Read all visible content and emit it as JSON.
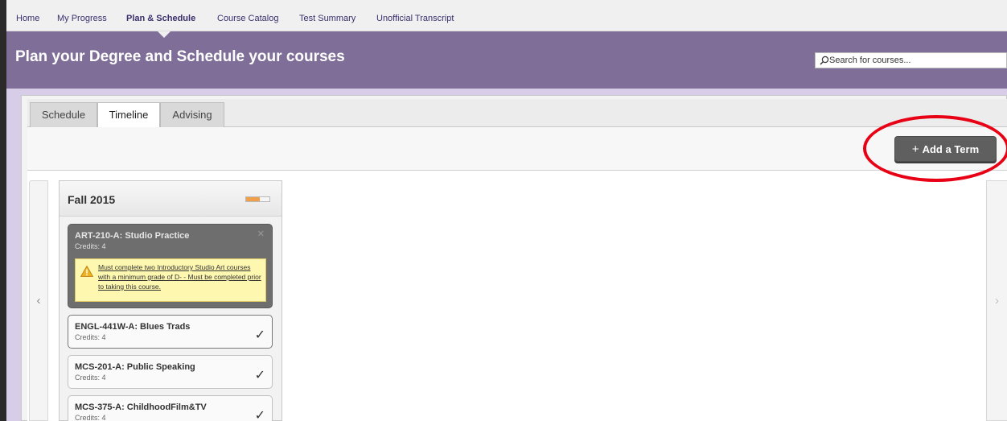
{
  "nav": {
    "items": [
      {
        "label": "Home"
      },
      {
        "label": "My Progress"
      },
      {
        "label": "Plan & Schedule",
        "active": true
      },
      {
        "label": "Course Catalog"
      },
      {
        "label": "Test Summary"
      },
      {
        "label": "Unofficial Transcript"
      }
    ]
  },
  "header": {
    "title": "Plan your Degree and Schedule your courses",
    "search_placeholder": "Search for courses..."
  },
  "tabs": [
    {
      "label": "Schedule"
    },
    {
      "label": "Timeline",
      "active": true
    },
    {
      "label": "Advising"
    }
  ],
  "toolbar": {
    "add_term_label": "Add a Term",
    "add_term_plus": "+"
  },
  "term": {
    "title": "Fall 2015",
    "progress_fraction": 0.6,
    "courses": [
      {
        "name": "ART-210-A: Studio Practice",
        "credits": "Credits: 4",
        "warning": "Must complete two Introductory Studio Art courses with a minimum grade of D- - Must be completed prior to taking this course."
      },
      {
        "name": "ENGL-441W-A: Blues Trads",
        "credits": "Credits: 4"
      },
      {
        "name": "MCS-201-A: Public Speaking",
        "credits": "Credits: 4"
      },
      {
        "name": "MCS-375-A: ChildhoodFilm&TV",
        "credits": "Credits: 4"
      }
    ]
  },
  "colors": {
    "header_purple": "#7f6f98",
    "band_lavender": "#d8cde8",
    "nav_text": "#3c2f6e",
    "button_gray": "#5f5f5f",
    "highlight_red": "#e80014",
    "progress_orange": "#f0a04a",
    "warning_yellow": "#fdf7b0"
  },
  "icons": {
    "search": "magnifier-icon",
    "check": "checkmark-icon",
    "close": "close-icon",
    "warning": "warning-triangle-icon",
    "prev": "chevron-left-icon",
    "next": "chevron-right-icon"
  }
}
